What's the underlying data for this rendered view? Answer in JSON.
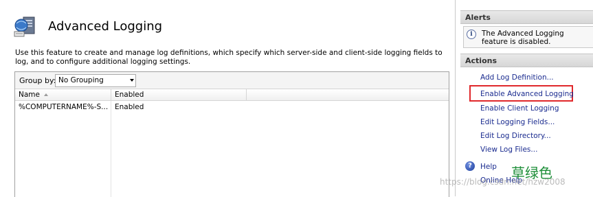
{
  "page": {
    "title": "Advanced Logging",
    "description": "Use this feature to create and manage log definitions, which specify which server-side and client-side logging fields to log, and to configure additional logging settings.",
    "feature_icon": "advanced-logging-icon"
  },
  "list": {
    "group_by_label": "Group by:",
    "group_by_value": "No Grouping",
    "columns": [
      "Name",
      "Enabled"
    ],
    "rows": [
      {
        "name": "%COMPUTERNAME%-S...",
        "enabled": "Enabled"
      }
    ]
  },
  "alerts": {
    "title": "Alerts",
    "message": "The Advanced Logging feature is disabled."
  },
  "actions": {
    "title": "Actions",
    "items": [
      "Add Log Definition...",
      "Enable Advanced Logging",
      "Enable Client Logging",
      "Edit Logging Fields...",
      "Edit Log Directory...",
      "View Log Files..."
    ],
    "help": "Help",
    "online_help": "Online Help"
  },
  "watermark": {
    "chinese": "草绿色",
    "url": "https://blog.csdn.net/hzw2008"
  },
  "colors": {
    "highlight": "#e0272a",
    "link": "#1a2b8f",
    "watermark_green": "#1f8f3a"
  }
}
